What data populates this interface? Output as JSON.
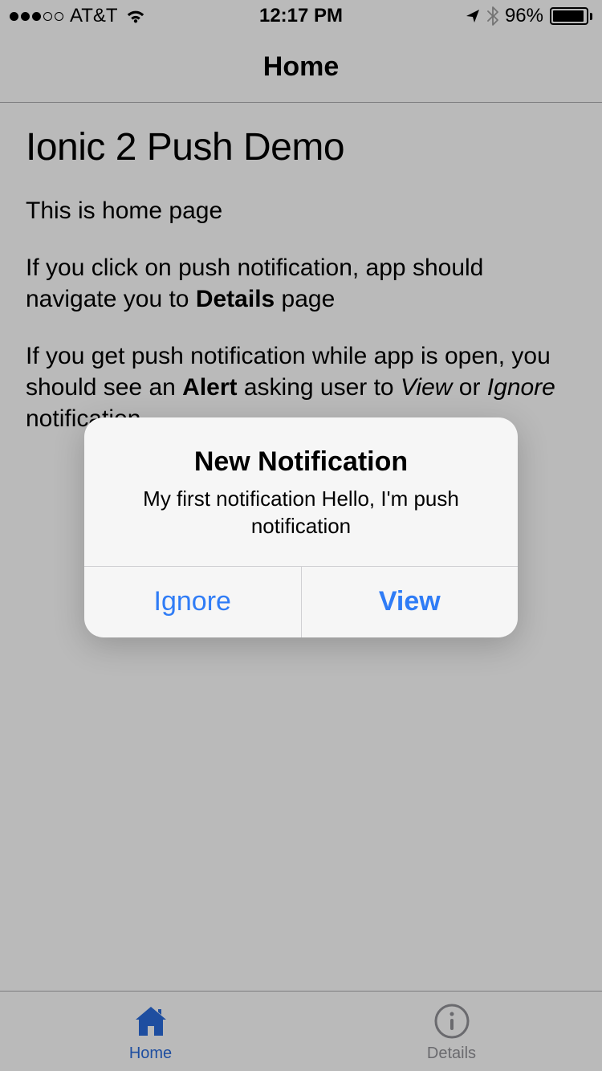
{
  "status_bar": {
    "carrier": "AT&T",
    "time": "12:17 PM",
    "battery_percent": "96%"
  },
  "header": {
    "title": "Home"
  },
  "content": {
    "heading": "Ionic 2 Push Demo",
    "para1": "This is home page",
    "para2_pre": "If you click on push notification, app should navigate you to ",
    "para2_bold": "Details",
    "para2_post": " page",
    "para3_pre": "If you get push notification while app is open, you should see an ",
    "para3_b1": "Alert",
    "para3_mid1": " asking user to ",
    "para3_i1": "View",
    "para3_mid2": " or ",
    "para3_i2": "Ignore",
    "para3_post": " notification"
  },
  "alert": {
    "title": "New Notification",
    "message": "My first notification Hello, I'm push notification",
    "button_ignore": "Ignore",
    "button_view": "View"
  },
  "tabs": {
    "home": "Home",
    "details": "Details"
  }
}
